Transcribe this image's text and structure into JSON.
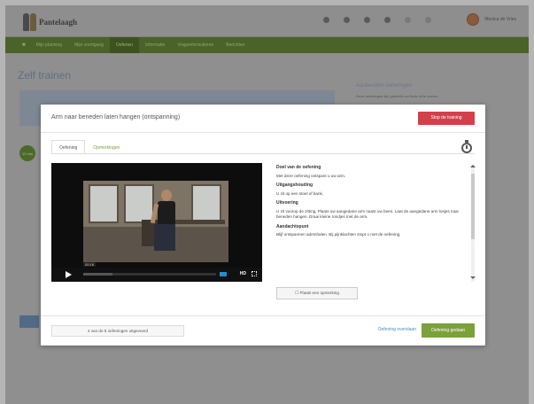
{
  "header": {
    "logo_text": "Pantelaagh",
    "logo_sub": "",
    "user_name": "Monica de Vries"
  },
  "nav": {
    "home_icon": "home-icon",
    "items": [
      {
        "label": "Mijn planning",
        "active": false
      },
      {
        "label": "Mijn voortgang",
        "active": false
      },
      {
        "label": "Oefenen",
        "active": true
      },
      {
        "label": "Informatie",
        "active": false
      },
      {
        "label": "Vragenformulieren",
        "active": false
      },
      {
        "label": "Berichten",
        "active": false
      }
    ]
  },
  "page": {
    "title": "Zelf trainen",
    "sidebar_title": "Aanbevolen oefeningen",
    "sidebar_text": "Deze oefeningen zijn geschikt om thuis uit te voeren.",
    "badge_text": "12 min"
  },
  "modal": {
    "title": "Arm naar beneden laten hangen (ontspanning)",
    "stop_label": "Stop de training",
    "tabs": [
      {
        "label": "Oefening",
        "active": true
      },
      {
        "label": "Opmerkingen",
        "active": false
      }
    ],
    "video": {
      "time": "00:16",
      "hd_label": "HD",
      "progress": 0.22
    },
    "sections": [
      {
        "heading": "Doel van de oefening",
        "text": "Met deze oefening ontspant u uw arm."
      },
      {
        "heading": "Uitgangshouding",
        "text": "U zit op een stoel of bank."
      },
      {
        "heading": "Uitvoering",
        "text": "U zit voorop de zitting. Plaats uw aangedane arm naast uw been. Laat de aangedane arm losjes naar beneden hangen. Draai kleine rondjes met de arm."
      },
      {
        "heading": "Aandachtspunt",
        "text": "Blijf ontspannen ademhalen. Bij pijnklachten stopt u met de oefening."
      }
    ],
    "note_label": "Plaats een opmerking",
    "count_label": "4 van de 6 oefeningen uitgevoerd",
    "skip_label": "Oefening overslaan",
    "done_label": "Oefening gedaan"
  },
  "colors": {
    "accent": "#7aa13a",
    "danger": "#d2404a",
    "link": "#4a8ac8"
  }
}
